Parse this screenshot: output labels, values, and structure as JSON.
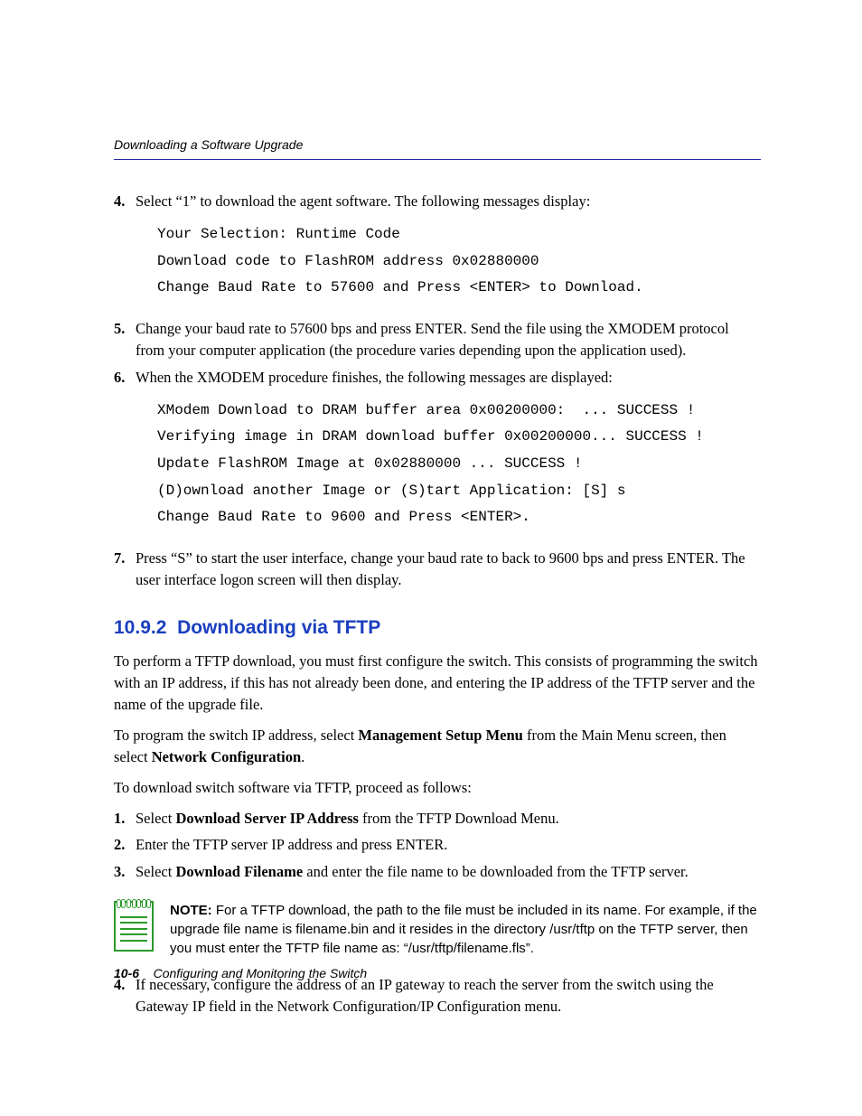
{
  "header": {
    "running": "Downloading a Software Upgrade"
  },
  "listA": {
    "items": [
      {
        "num": "4.",
        "text": "Select “1” to download the agent software. The following messages display:",
        "code": "Your Selection: Runtime Code\nDownload code to FlashROM address 0x02880000\nChange Baud Rate to 57600 and Press <ENTER> to Download."
      },
      {
        "num": "5.",
        "text": "Change your baud rate to 57600 bps and press ENTER. Send the file using the XMODEM protocol from your computer application (the procedure varies depending upon the application used)."
      },
      {
        "num": "6.",
        "text": "When the XMODEM procedure finishes, the following messages are displayed:",
        "code": "XModem Download to DRAM buffer area 0x00200000:  ... SUCCESS !\nVerifying image in DRAM download buffer 0x00200000... SUCCESS !\nUpdate FlashROM Image at 0x02880000 ... SUCCESS !\n(D)ownload another Image or (S)tart Application: [S] s\nChange Baud Rate to 9600 and Press <ENTER>."
      },
      {
        "num": "7.",
        "text": "Press “S” to start the user interface, change your baud rate to back to 9600 bps and press ENTER. The user interface logon screen will then display."
      }
    ]
  },
  "section": {
    "number": "10.9.2",
    "title": "Downloading via TFTP",
    "p1": "To perform a TFTP download, you must first configure the switch. This consists of programming the switch with an IP address, if this has not already been done, and entering the IP address of the TFTP server and the name of the upgrade file.",
    "p2_pre": "To program the switch IP address, select ",
    "p2_b1": "Management Setup Menu",
    "p2_mid": " from the Main Menu screen, then select ",
    "p2_b2": "Network Configuration",
    "p2_post": ".",
    "p3": "To download switch software via TFTP, proceed as follows:"
  },
  "listB": {
    "items": [
      {
        "num": "1.",
        "pre": "Select ",
        "bold": "Download Server IP Address",
        "post": " from the TFTP Download Menu."
      },
      {
        "num": "2.",
        "pre": "",
        "bold": "",
        "post": "Enter the TFTP server IP address and press ENTER."
      },
      {
        "num": "3.",
        "pre": "Select ",
        "bold": "Download Filename",
        "post": " and enter the file name to be downloaded from the TFTP server."
      }
    ]
  },
  "note": {
    "label": "NOTE:",
    "text": "  For a TFTP download, the path to the file must be included in its name. For example, if the upgrade file name is filename.bin and it resides in the directory /usr/tftp on the TFTP server, then you must enter the TFTP file name as: “/usr/tftp/filename.fls”."
  },
  "listC": {
    "items": [
      {
        "num": "4.",
        "text": "If necessary, configure the address of an IP gateway to reach the server from the switch using the Gateway IP field in the Network Configuration/IP Configuration menu."
      }
    ]
  },
  "footer": {
    "page": "10-6",
    "title": "Configuring and Monitoring the Switch"
  }
}
